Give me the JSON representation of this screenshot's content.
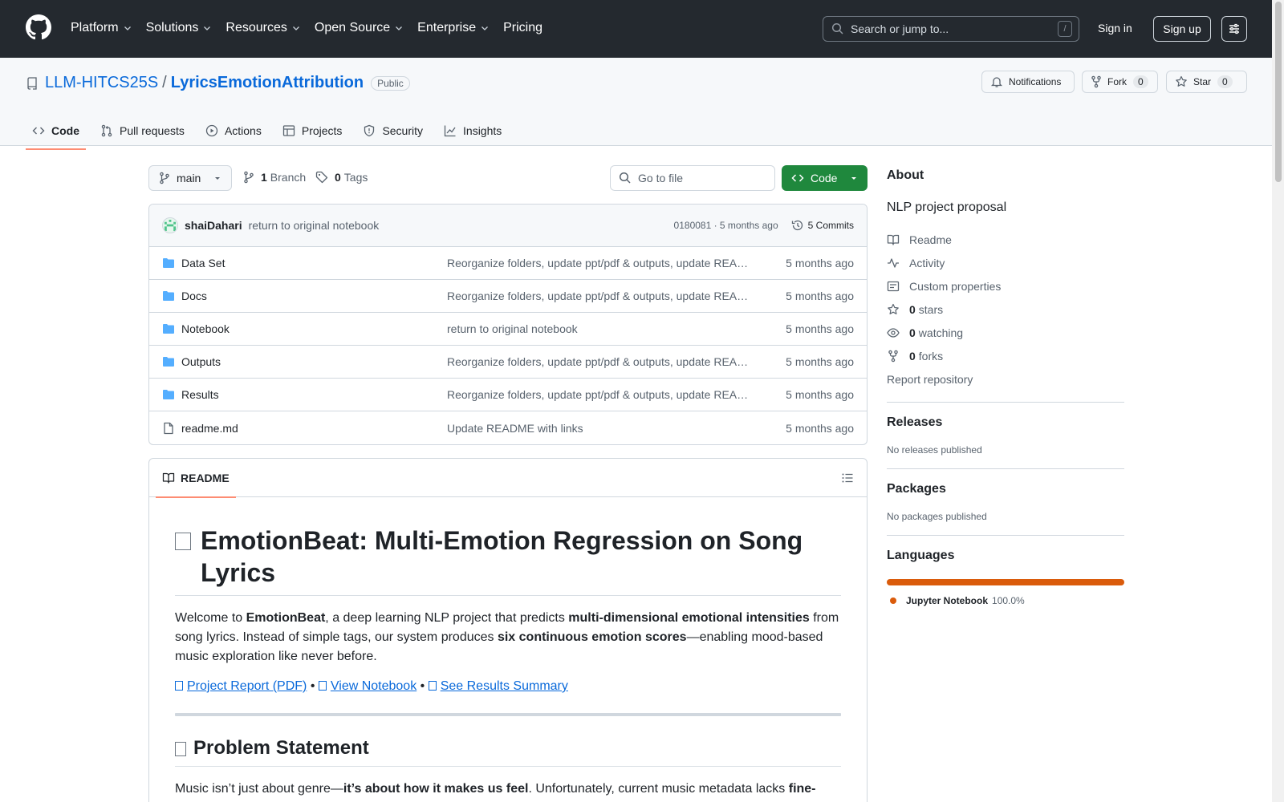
{
  "header": {
    "nav": [
      "Platform",
      "Solutions",
      "Resources",
      "Open Source",
      "Enterprise",
      "Pricing"
    ],
    "search_placeholder": "Search or jump to...",
    "search_shortcut": "/",
    "sign_in": "Sign in",
    "sign_up": "Sign up"
  },
  "repo": {
    "owner": "LLM-HITCS25S",
    "separator": "/",
    "name": "LyricsEmotionAttribution",
    "visibility": "Public",
    "notifications_label": "Notifications",
    "fork_label": "Fork",
    "fork_count": "0",
    "star_label": "Star",
    "star_count": "0"
  },
  "tabs": [
    "Code",
    "Pull requests",
    "Actions",
    "Projects",
    "Security",
    "Insights"
  ],
  "branch_bar": {
    "branch": "main",
    "branch_count": "1",
    "branch_label": "Branch",
    "tag_count": "0",
    "tag_label": "Tags",
    "goto_placeholder": "Go to file",
    "code_label": "Code"
  },
  "latest_commit": {
    "author": "shaiDahari",
    "message": "return to original notebook",
    "hash_time": "0180081 · 5 months ago",
    "commits_label": "5 Commits"
  },
  "files": [
    {
      "name": "Data Set",
      "type": "folder",
      "message": "Reorganize folders, update ppt/pdf & outputs, update README",
      "date": "5 months ago"
    },
    {
      "name": "Docs",
      "type": "folder",
      "message": "Reorganize folders, update ppt/pdf & outputs, update README",
      "date": "5 months ago"
    },
    {
      "name": "Notebook",
      "type": "folder",
      "message": "return to original notebook",
      "date": "5 months ago"
    },
    {
      "name": "Outputs",
      "type": "folder",
      "message": "Reorganize folders, update ppt/pdf & outputs, update README",
      "date": "5 months ago"
    },
    {
      "name": "Results",
      "type": "folder",
      "message": "Reorganize folders, update ppt/pdf & outputs, update README",
      "date": "5 months ago"
    },
    {
      "name": "readme.md",
      "type": "file",
      "message": "Update README with links",
      "date": "5 months ago"
    }
  ],
  "readme": {
    "tab_label": "README",
    "title": "EmotionBeat: Multi-Emotion Regression on Song Lyrics",
    "intro": {
      "p1": "Welcome to ",
      "b1": "EmotionBeat",
      "p2": ", a deep learning NLP project that predicts ",
      "b2": "multi-dimensional emotional intensities",
      "p3": " from song lyrics. Instead of simple tags, our system produces ",
      "b3": "six continuous emotion scores",
      "p4": "—enabling mood-based music exploration like never before."
    },
    "links": [
      "Project Report (PDF)",
      "View Notebook",
      "See Results Summary"
    ],
    "link_sep": " • ",
    "h2": "Problem Statement",
    "problem": {
      "p1": "Music isn’t just about genre—",
      "b1": "it’s about how it makes us feel",
      "p2": ". Unfortunately, current music metadata lacks ",
      "b2": "fine-"
    }
  },
  "sidebar": {
    "about_title": "About",
    "description": "NLP project proposal",
    "readme": "Readme",
    "activity": "Activity",
    "custom_properties": "Custom properties",
    "stars_count": "0",
    "stars_label": "stars",
    "watching_count": "0",
    "watching_label": "watching",
    "forks_count": "0",
    "forks_label": "forks",
    "report": "Report repository",
    "releases_title": "Releases",
    "releases_empty": "No releases published",
    "packages_title": "Packages",
    "packages_empty": "No packages published",
    "languages_title": "Languages",
    "languages": [
      {
        "name": "Jupyter Notebook",
        "percent": "100.0%",
        "color": "#DA5B0B"
      }
    ]
  }
}
